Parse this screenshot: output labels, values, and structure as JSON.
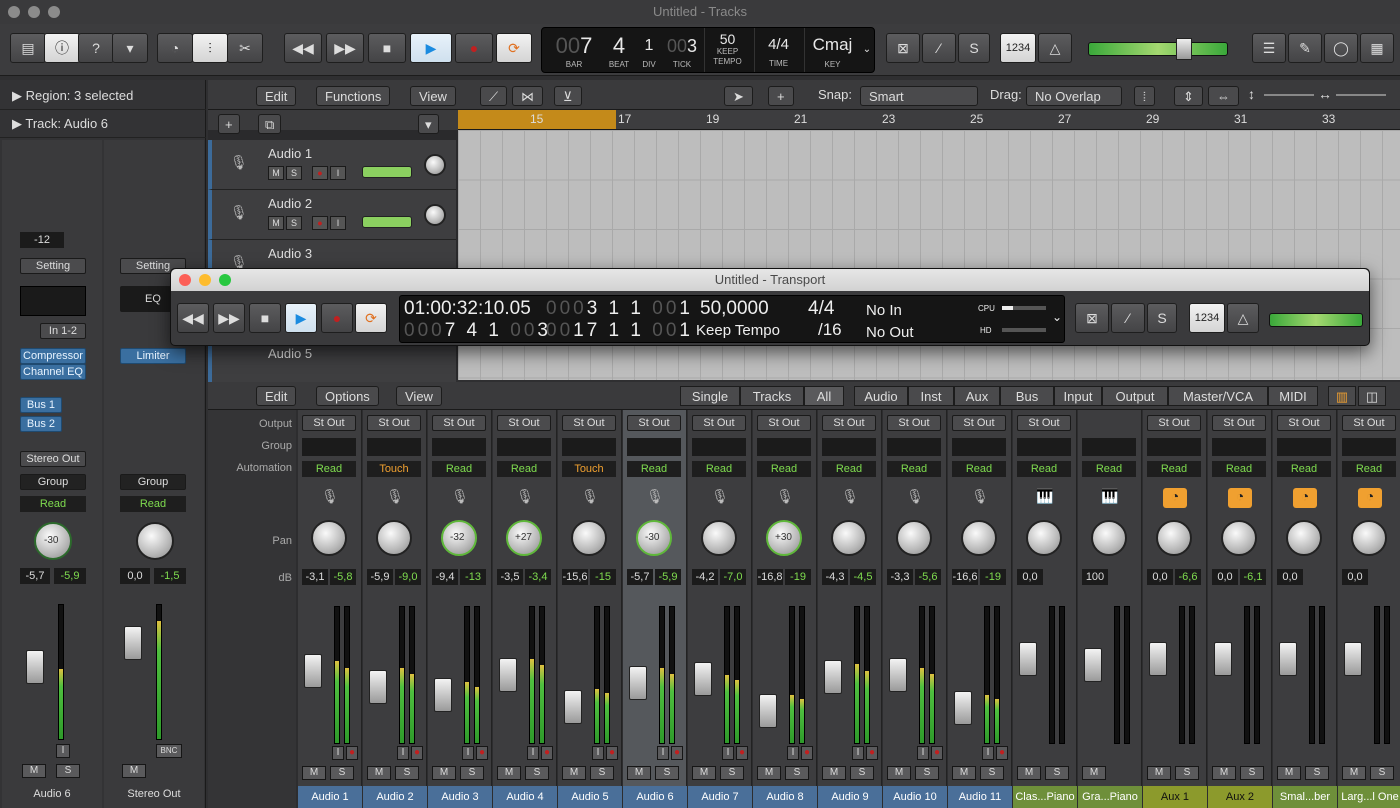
{
  "window": {
    "title": "Untitled - Tracks"
  },
  "control_bar": {
    "lcd": {
      "bar": "7",
      "bar_dim": "00",
      "bar_label": "BAR",
      "beat": "4",
      "beat_label": "BEAT",
      "div": "1",
      "div_label": "DIV",
      "tick": "3",
      "tick_dim": "00",
      "tick_label": "TICK",
      "tempo": "50",
      "tempo_sub": "KEEP",
      "tempo_label": "TEMPO",
      "time": "4/4",
      "time_label": "TIME",
      "key": "Cmaj",
      "key_label": "KEY"
    },
    "count_in": "1234"
  },
  "inspector": {
    "region": "Region:",
    "region_value": "3 selected",
    "track": "Track:",
    "track_value": "Audio 6",
    "left_strip": {
      "gain": "-12",
      "setting": "Setting",
      "input": "In 1-2",
      "plugins": [
        "Compressor",
        "Channel EQ"
      ],
      "sends": [
        "Bus 1",
        "Bus 2"
      ],
      "output": "Stereo Out",
      "group": "Group",
      "automation": "Read",
      "pan": "-30",
      "db_left": "-5,7",
      "db_right": "-5,9",
      "name": "Audio 6"
    },
    "right_strip": {
      "setting": "Setting",
      "eq": "EQ",
      "plugins": [
        "Limiter"
      ],
      "group": "Group",
      "automation": "Read",
      "db_left": "0,0",
      "db_right": "-1,5",
      "bnc": "BNC",
      "name": "Stereo Out"
    }
  },
  "tracks_toolbar": {
    "edit": "Edit",
    "functions": "Functions",
    "view": "View",
    "snap_label": "Snap:",
    "snap_value": "Smart",
    "drag_label": "Drag:",
    "drag_value": "No Overlap"
  },
  "ruler": [
    "15",
    "17",
    "19",
    "21",
    "23",
    "25",
    "27",
    "29",
    "31",
    "33"
  ],
  "tracks": [
    {
      "name": "Audio 1"
    },
    {
      "name": "Audio 2"
    },
    {
      "name": "Audio 3"
    },
    {
      "name": "Audio 5"
    }
  ],
  "transport": {
    "title": "Untitled - Transport",
    "smpte": "01:00:32:10.05",
    "pos_dim": "000",
    "pos": "7 4 1",
    "pos_tick_dim": "00",
    "pos_tick": "3",
    "loop_start_dim": "000",
    "loop_start": "3 1 1",
    "loop_start_tick_dim": "00",
    "loop_start_tick": "1",
    "loop_end_dim": "00",
    "loop_end": "17 1 1",
    "loop_end_tick_dim": "00",
    "loop_end_tick": "1",
    "tempo": "50,0000",
    "tempo_mode": "Keep Tempo",
    "sig": "4/4",
    "division": "/16",
    "midi_in": "No In",
    "midi_out": "No Out",
    "cpu": "CPU",
    "hd": "HD",
    "count_in": "1234"
  },
  "mixer_toolbar": {
    "edit": "Edit",
    "options": "Options",
    "view": "View",
    "modes": [
      "Single",
      "Tracks",
      "All"
    ],
    "filters": [
      "Audio",
      "Inst",
      "Aux",
      "Bus",
      "Input",
      "Output",
      "Master/VCA",
      "MIDI"
    ]
  },
  "mixer_labels": {
    "output": "Output",
    "group": "Group",
    "automation": "Automation",
    "pan": "Pan",
    "db": "dB"
  },
  "channels": [
    {
      "name": "Audio 1",
      "out": "St Out",
      "auto": "Read",
      "pan": "",
      "l": "-3,1",
      "r": "-5,8",
      "fader": 0.55,
      "meter": 0.6,
      "color": "blue"
    },
    {
      "name": "Audio 2",
      "out": "St Out",
      "auto": "Touch",
      "pan": "",
      "l": "-5,9",
      "r": "-9,0",
      "fader": 0.42,
      "meter": 0.55,
      "color": "blue"
    },
    {
      "name": "Audio 3",
      "out": "St Out",
      "auto": "Read",
      "pan": "-32",
      "l": "-9,4",
      "r": "-13",
      "fader": 0.35,
      "meter": 0.45,
      "color": "blue"
    },
    {
      "name": "Audio 4",
      "out": "St Out",
      "auto": "Read",
      "pan": "+27",
      "l": "-3,5",
      "r": "-3,4",
      "fader": 0.52,
      "meter": 0.62,
      "color": "blue"
    },
    {
      "name": "Audio 5",
      "out": "St Out",
      "auto": "Touch",
      "pan": "",
      "l": "-15,6",
      "r": "-15",
      "fader": 0.25,
      "meter": 0.4,
      "color": "blue"
    },
    {
      "name": "Audio 6",
      "out": "St Out",
      "auto": "Read",
      "pan": "-30",
      "l": "-5,7",
      "r": "-5,9",
      "fader": 0.45,
      "meter": 0.55,
      "color": "blue",
      "selected": true
    },
    {
      "name": "Audio 7",
      "out": "St Out",
      "auto": "Read",
      "pan": "",
      "l": "-4,2",
      "r": "-7,0",
      "fader": 0.48,
      "meter": 0.5,
      "color": "blue"
    },
    {
      "name": "Audio 8",
      "out": "St Out",
      "auto": "Read",
      "pan": "+30",
      "l": "-16,8",
      "r": "-19",
      "fader": 0.22,
      "meter": 0.35,
      "color": "blue"
    },
    {
      "name": "Audio 9",
      "out": "St Out",
      "auto": "Read",
      "pan": "",
      "l": "-4,3",
      "r": "-4,5",
      "fader": 0.5,
      "meter": 0.58,
      "color": "blue"
    },
    {
      "name": "Audio 10",
      "out": "St Out",
      "auto": "Read",
      "pan": "",
      "l": "-3,3",
      "r": "-5,6",
      "fader": 0.52,
      "meter": 0.55,
      "color": "blue"
    },
    {
      "name": "Audio 11",
      "out": "St Out",
      "auto": "Read",
      "pan": "",
      "l": "-16,6",
      "r": "-19",
      "fader": 0.24,
      "meter": 0.35,
      "color": "blue"
    },
    {
      "name": "Clas...Piano",
      "out": "St Out",
      "auto": "Read",
      "pan": "",
      "l": "0,0",
      "r": "",
      "fader": 0.65,
      "meter": 0,
      "color": "green",
      "instrument": true
    },
    {
      "name": "Gra...Piano",
      "out": "",
      "auto": "Read",
      "pan": "",
      "l": "100",
      "r": "",
      "fader": 0.6,
      "meter": 0,
      "color": "green",
      "instrument": true
    },
    {
      "name": "Aux 1",
      "out": "St Out",
      "auto": "Read",
      "pan": "",
      "l": "0,0",
      "r": "-6,6",
      "fader": 0.65,
      "meter": 0.0,
      "color": "olive",
      "aux": true
    },
    {
      "name": "Aux 2",
      "out": "St Out",
      "auto": "Read",
      "pan": "",
      "l": "0,0",
      "r": "-6,1",
      "fader": 0.65,
      "meter": 0.0,
      "color": "olive",
      "aux": true
    },
    {
      "name": "Smal...ber",
      "out": "St Out",
      "auto": "Read",
      "pan": "",
      "l": "0,0",
      "r": "",
      "fader": 0.65,
      "meter": 0.0,
      "color": "green",
      "aux": true
    },
    {
      "name": "Larg...l One",
      "out": "St Out",
      "auto": "Read",
      "pan": "",
      "l": "0,0",
      "r": "",
      "fader": 0.65,
      "meter": 0.0,
      "color": "green",
      "aux": true
    }
  ],
  "ms": {
    "m": "M",
    "s": "S",
    "i": "I"
  }
}
